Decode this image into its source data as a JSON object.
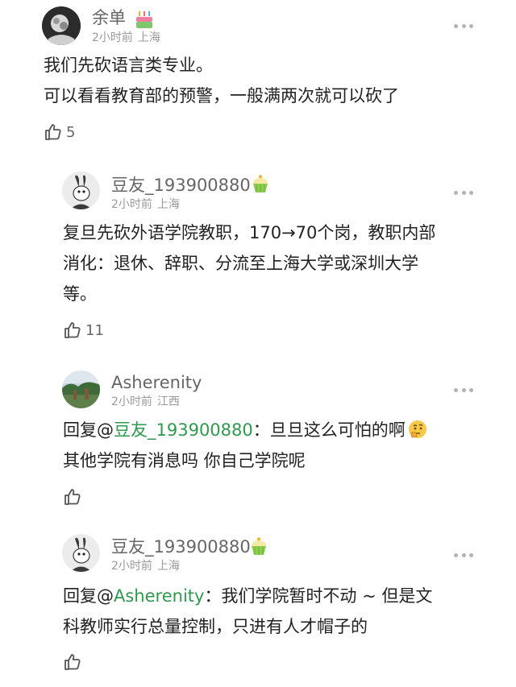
{
  "comments": [
    {
      "username": "余单",
      "time": "2小时前",
      "location": "上海",
      "lines": [
        "我们先砍语言类专业。",
        "可以看看教育部的预警，一般满两次就可以砍了"
      ],
      "likes": "5",
      "badge": "cake-badge-icon"
    },
    {
      "username": "豆友_193900880",
      "time": "2小时前",
      "location": "上海",
      "lines": [
        "复旦先砍外语学院教职，170→70个岗，教职内部",
        "消化：退休、辞职、分流至上海大学或深圳大学",
        "等。"
      ],
      "likes": "11",
      "badge": "cupcake-badge-icon"
    },
    {
      "username": "Asherenity",
      "time": "2小时前",
      "location": "江西",
      "reply_prefix": "回复@",
      "reply_to": "豆友_193900880",
      "line1_rest": "：旦旦这么可怕的啊",
      "line2": "其他学院有消息吗 你自己学院呢",
      "likes": "",
      "emoji": "thinking-face-icon"
    },
    {
      "username": "豆友_193900880",
      "time": "2小时前",
      "location": "上海",
      "reply_prefix": "回复@",
      "reply_to": "Asherenity",
      "line1_rest": "：我们学院暂时不动 ~ 但是文",
      "line2": "科教师实行总量控制，只进有人才帽子的",
      "likes": "",
      "badge": "cupcake-badge-icon"
    }
  ],
  "colors": {
    "mention": "#2f9a4f",
    "text": "#222222",
    "meta": "#9a9a9a"
  }
}
